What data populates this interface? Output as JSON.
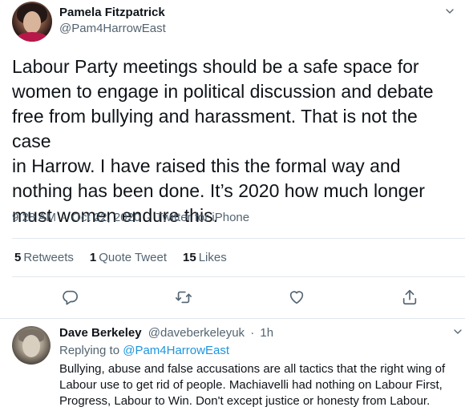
{
  "tweet": {
    "author_name": "Pamela Fitzpatrick",
    "author_handle": "@Pam4HarrowEast",
    "text": "Labour Party meetings should be a safe space for\nwomen to engage in political discussion and debate\nfree from bullying and harassment. That is not the case\nin Harrow.  I have raised this the formal way and\nnothing has been done. It’s 2020 how much longer\nmust women endure this.",
    "time": "9:28 AM",
    "date": "Oct 22, 2020",
    "source": "Twitter for iPhone",
    "separator": "·",
    "stats": {
      "retweets_count": "5",
      "retweets_label": "Retweets",
      "quote_count": "1",
      "quote_label": "Quote Tweet",
      "likes_count": "15",
      "likes_label": "Likes"
    }
  },
  "reply": {
    "author_name": "Dave Berkeley",
    "author_handle": "@daveberkeleyuk",
    "separator": "·",
    "time": "1h",
    "replying_prefix": "Replying to",
    "replying_to": "@Pam4HarrowEast",
    "text": "Bullying, abuse and false accusations are all tactics that the right wing of Labour use to get rid of people. Machiavelli had nothing on Labour First, Progress, Labour to Win. Don't except justice or honesty from Labour."
  },
  "icons": {
    "reply": "reply-icon",
    "retweet": "retweet-icon",
    "like": "heart-icon",
    "share": "share-icon",
    "more": "chevron-down-icon"
  },
  "colors": {
    "text_primary": "#0f1419",
    "text_secondary": "#536471",
    "link": "#1b95e0",
    "divider": "#e1e8ed"
  }
}
